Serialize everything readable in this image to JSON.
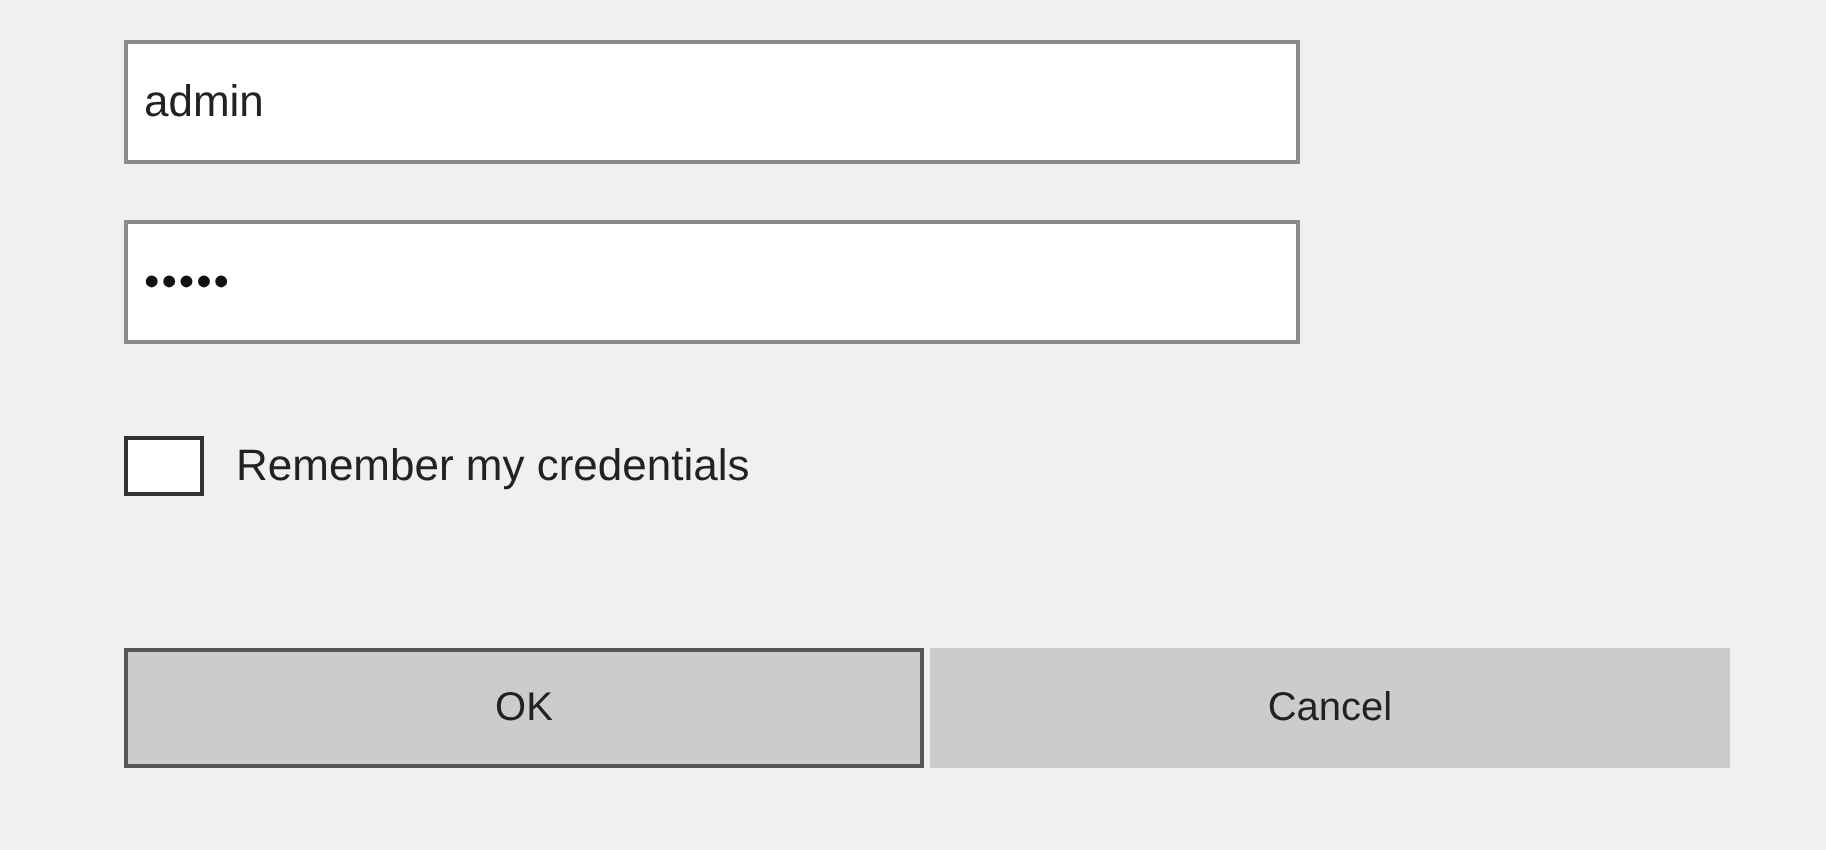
{
  "username": {
    "value": "admin"
  },
  "password": {
    "value": "•••••"
  },
  "remember": {
    "label": "Remember my credentials",
    "checked": false
  },
  "buttons": [
    {
      "label": "OK",
      "focused": true
    },
    {
      "label": "Cancel",
      "focused": false
    }
  ]
}
